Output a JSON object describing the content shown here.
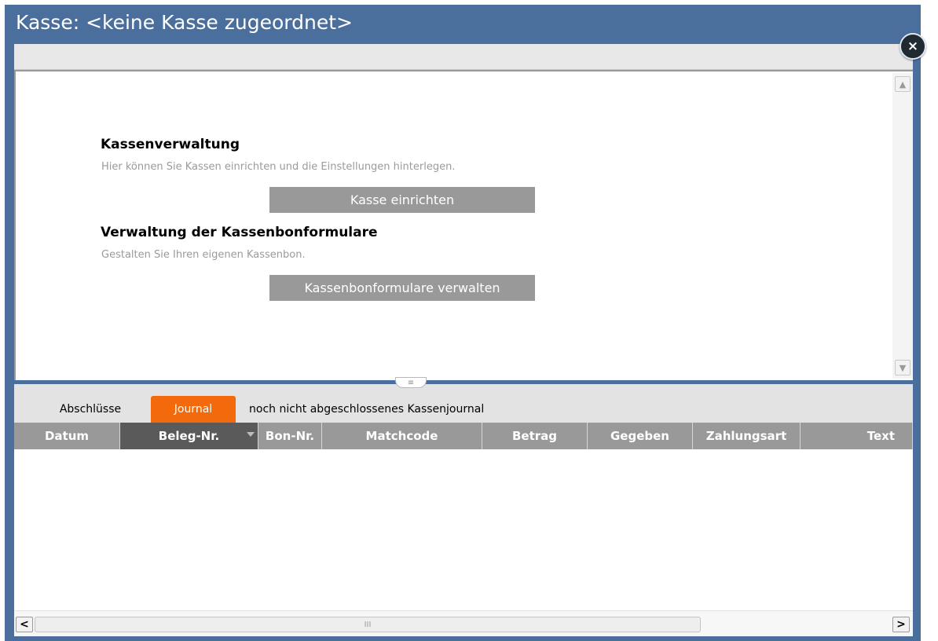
{
  "window": {
    "title": "Kasse: <keine Kasse zugeordnet>",
    "close_icon": "×"
  },
  "top_panel": {
    "sections": [
      {
        "heading": "Kassenverwaltung",
        "description": "Hier können Sie Kassen einrichten und die Einstellungen hinterlegen.",
        "button_label": "Kasse einrichten"
      },
      {
        "heading": "Verwaltung der Kassenbonformulare",
        "description": "Gestalten Sie Ihren eigenen Kassenbon.",
        "button_label": "Kassenbonformulare verwalten"
      }
    ],
    "scroll_up_icon": "▲",
    "scroll_down_icon": "▼"
  },
  "splitter": {
    "icon": "≡"
  },
  "tabs": {
    "items": [
      {
        "label": "Abschlüsse",
        "active": false
      },
      {
        "label": "Journal",
        "active": true
      }
    ],
    "caption": "noch nicht abgeschlossenes Kassenjournal",
    "active_color": "#f26a0b"
  },
  "grid": {
    "columns": [
      {
        "label": "Datum"
      },
      {
        "label": "Beleg-Nr.",
        "sorted": true
      },
      {
        "label": "Bon-Nr."
      },
      {
        "label": "Matchcode"
      },
      {
        "label": "Betrag"
      },
      {
        "label": "Gegeben"
      },
      {
        "label": "Zahlungsart"
      },
      {
        "label": "Text"
      }
    ],
    "rows": []
  },
  "hscroll": {
    "left_icon": "<",
    "right_icon": ">",
    "grip": "III"
  },
  "colors": {
    "frame": "#4b6f9d",
    "header_bg": "#999999",
    "sorted_header_bg": "#5a5a5a"
  }
}
